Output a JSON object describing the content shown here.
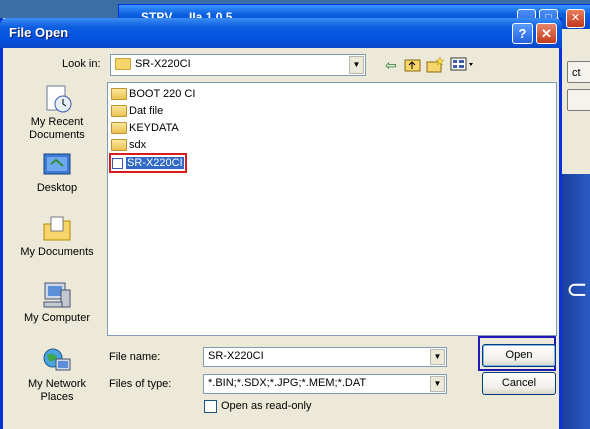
{
  "background_window": {
    "title": "STPV ... IIa 1.0.5",
    "side_button_text": "ct"
  },
  "dialog": {
    "title": "File Open",
    "help_button": "?",
    "close_button": "✕"
  },
  "look_in": {
    "label": "Look in:",
    "value": "SR-X220CI"
  },
  "toolbar": {
    "icons": [
      "back-arrow-icon",
      "up-folder-icon",
      "new-folder-icon",
      "view-menu-icon"
    ]
  },
  "places": [
    {
      "label": "My Recent Documents",
      "icon": "recent-documents-icon"
    },
    {
      "label": "Desktop",
      "icon": "desktop-icon"
    },
    {
      "label": "My Documents",
      "icon": "my-documents-icon"
    },
    {
      "label": "My Computer",
      "icon": "my-computer-icon"
    },
    {
      "label": "My Network Places",
      "icon": "network-places-icon"
    }
  ],
  "files": [
    {
      "name": "BOOT 220 CI",
      "type": "folder"
    },
    {
      "name": "Dat file",
      "type": "folder"
    },
    {
      "name": "KEYDATA",
      "type": "folder"
    },
    {
      "name": "sdx",
      "type": "folder"
    },
    {
      "name": "SR-X220CI",
      "type": "file",
      "selected": true
    }
  ],
  "file_name": {
    "label": "File name:",
    "value": "SR-X220CI"
  },
  "files_of_type": {
    "label": "Files of type:",
    "value": "*.BIN;*.SDX;*.JPG;*.MEM;*.DAT"
  },
  "buttons": {
    "open": "Open",
    "cancel": "Cancel"
  },
  "read_only": {
    "label": "Open as read-only",
    "checked": false
  },
  "colors": {
    "titlebar": "#0554e3",
    "selection": "#316ac5",
    "highlight_box": "#d61d1d"
  }
}
